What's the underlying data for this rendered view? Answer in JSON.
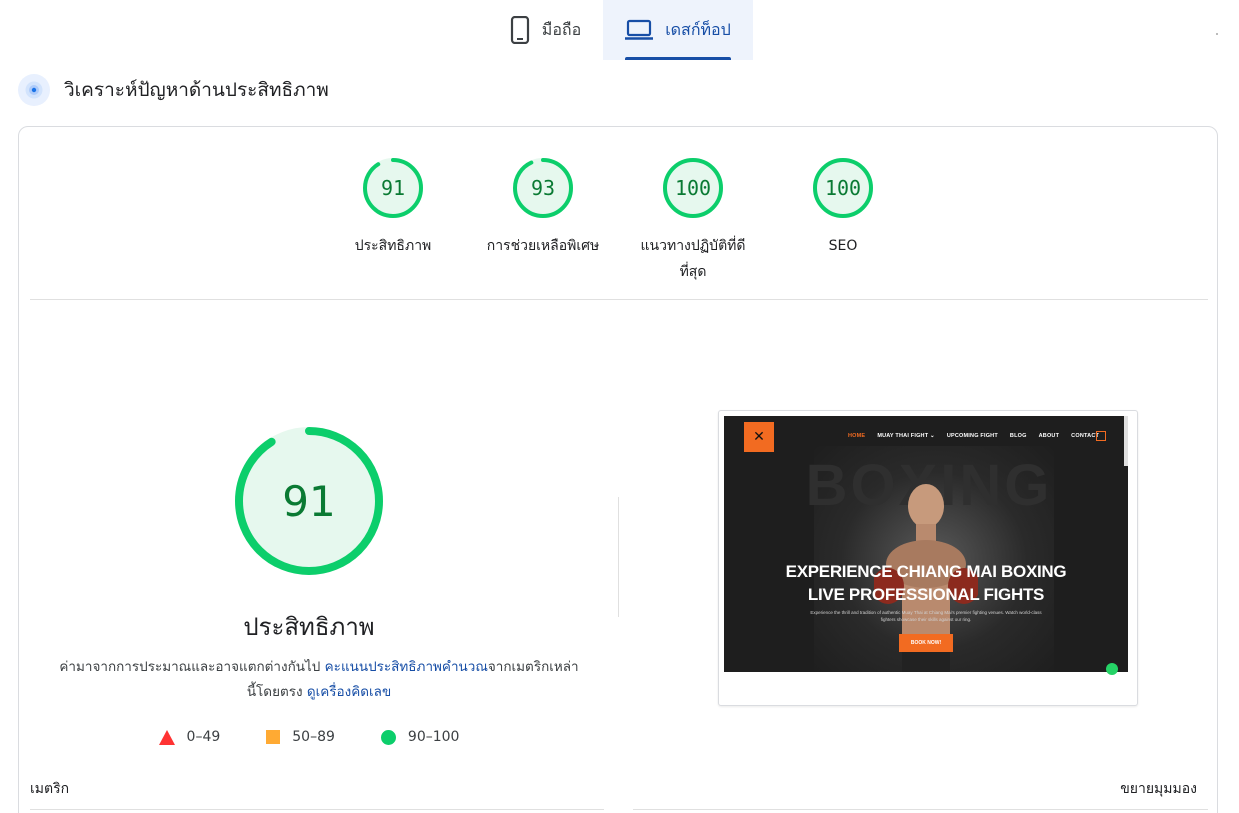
{
  "tabs": [
    {
      "label": "มือถือ",
      "icon": "phone-icon",
      "active": false
    },
    {
      "label": "เดสก์ท็อป",
      "icon": "laptop-icon",
      "active": true
    }
  ],
  "section": {
    "title": "วิเคราะห์ปัญหาด้านประสิทธิภาพ",
    "icon": "gauge-icon"
  },
  "scores": [
    {
      "value": "91",
      "label": "ประสิทธิภาพ",
      "percent": 91
    },
    {
      "value": "93",
      "label": "การช่วยเหลือพิเศษ",
      "percent": 93
    },
    {
      "value": "100",
      "label": "แนวทางปฏิบัติที่ดีที่สุด",
      "percent": 100
    },
    {
      "value": "100",
      "label": "SEO",
      "percent": 100
    }
  ],
  "main_score": {
    "value": "91",
    "title": "ประสิทธิภาพ",
    "percent": 91
  },
  "description": {
    "text1": "ค่ามาจากการประมาณและอาจแตกต่างกันไป ",
    "link1": "คะแนนประสิทธิภาพคำนวณ",
    "text2": "จากเมตริกเหล่านี้โดยตรง ",
    "link2": "ดูเครื่องคิดเลข"
  },
  "legend": [
    {
      "range": "0–49",
      "shape": "triangle",
      "color": "#ff3333"
    },
    {
      "range": "50–89",
      "shape": "square",
      "color": "#ffaa33"
    },
    {
      "range": "90–100",
      "shape": "circle",
      "color": "#0cce6b"
    }
  ],
  "screenshot": {
    "nav": [
      "HOME",
      "MUAY THAI FIGHT ⌄",
      "UPCOMING FIGHT",
      "BLOG",
      "ABOUT",
      "CONTACT"
    ],
    "watermark": "BOXING",
    "headline_line1": "EXPERIENCE CHIANG MAI BOXING",
    "headline_line2": "LIVE PROFESSIONAL FIGHTS",
    "subtext": "Experience the thrill and tradition of authentic Muay Thai at Chiang Mai's premier fighting venues. Watch world-class fighters showcase their skills against our ring.",
    "cta": "BOOK NOW!"
  },
  "footer": {
    "metrics_label": "เมตริก",
    "expand_label": "ขยายมุมมอง"
  },
  "colors": {
    "pass": "#0cce6b",
    "pass_text": "#0a7a33",
    "pass_bg": "#e6f8ee",
    "link": "#174ea6",
    "brand_orange": "#f26b21"
  }
}
